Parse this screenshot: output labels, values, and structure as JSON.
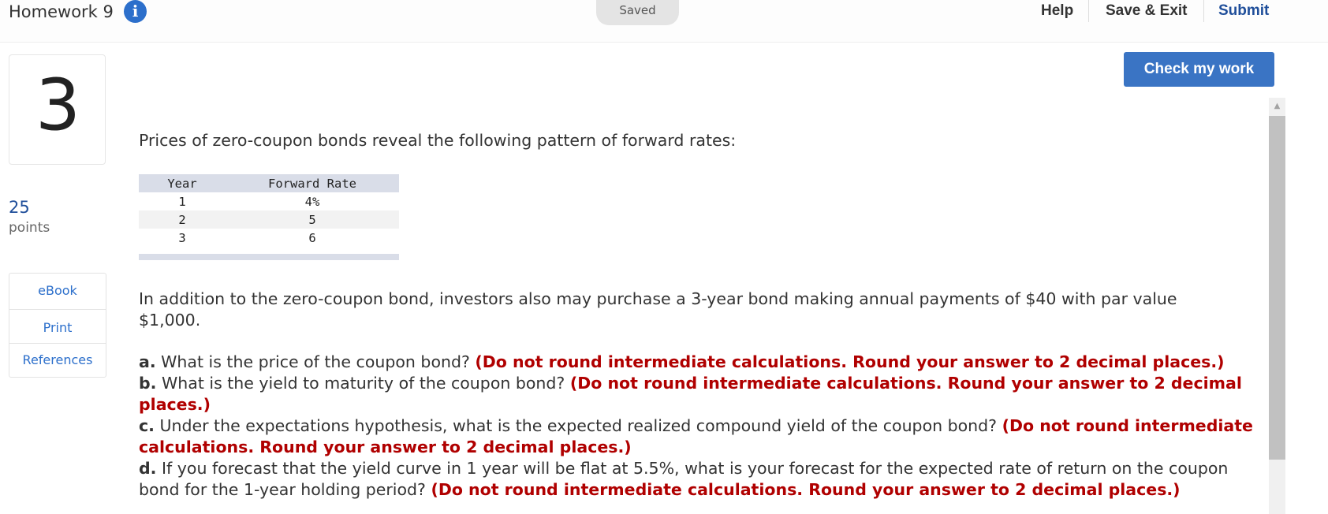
{
  "header": {
    "title": "Homework 9",
    "info_icon": "info-icon",
    "saved_label": "Saved",
    "help_label": "Help",
    "save_exit_label": "Save & Exit",
    "submit_label": "Submit"
  },
  "question": {
    "number": "3",
    "points_value": "25",
    "points_label": "points",
    "check_button_label": "Check my work",
    "side_links": {
      "ebook": "eBook",
      "print": "Print",
      "references": "References"
    },
    "intro": "Prices of zero-coupon bonds reveal the following pattern of forward rates:",
    "table": {
      "headers": [
        "Year",
        "Forward Rate"
      ],
      "rows": [
        [
          "1",
          "4%"
        ],
        [
          "2",
          "5"
        ],
        [
          "3",
          "6"
        ]
      ]
    },
    "addition": "In addition to the zero-coupon bond, investors also may purchase a 3-year bond making annual payments of $40 with par value $1,000.",
    "parts": [
      {
        "letter": "a.",
        "text": "What is the price of the coupon bond?",
        "note": "(Do not round intermediate calculations. Round your answer to 2 decimal places.)"
      },
      {
        "letter": "b.",
        "text": "What is the yield to maturity of the coupon bond?",
        "note": "(Do not round intermediate calculations. Round your answer to 2 decimal places.)"
      },
      {
        "letter": "c.",
        "text": "Under the expectations hypothesis, what is the expected realized compound yield of the coupon bond?",
        "note": "(Do not round intermediate calculations. Round your answer to 2 decimal places.)"
      },
      {
        "letter": "d.",
        "text": "If you forecast that the yield curve in 1 year will be flat at 5.5%, what is your forecast for the expected rate of return on the coupon bond for the 1-year holding period?",
        "note": "(Do not round intermediate calculations. Round your answer to 2 decimal places.)"
      }
    ]
  },
  "colors": {
    "brand_blue": "#1f4e9a",
    "button_blue": "#3a74c4",
    "link_blue": "#2c6fcb",
    "instruction_red": "#b00000"
  }
}
